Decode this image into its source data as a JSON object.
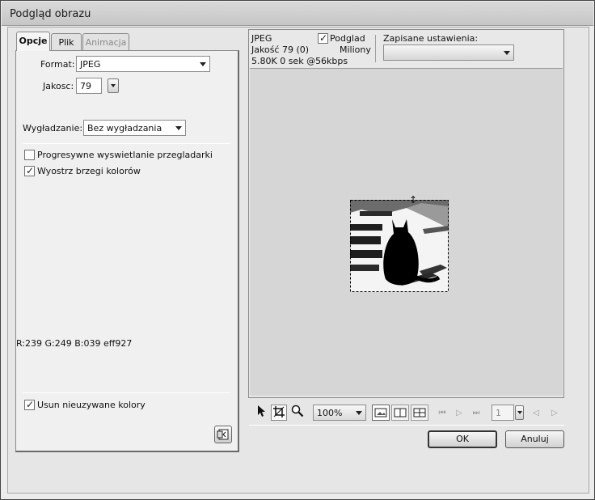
{
  "window": {
    "title": "Podgląd obrazu"
  },
  "tabs": [
    {
      "label": "Opcje",
      "active": true,
      "enabled": true
    },
    {
      "label": "Plik",
      "active": false,
      "enabled": true
    },
    {
      "label": "Animacja",
      "active": false,
      "enabled": false
    }
  ],
  "options": {
    "format_label": "Format:",
    "format_value": "JPEG",
    "quality_label": "Jakosc:",
    "quality_value": "79",
    "smoothing_label": "Wygładzanie:",
    "smoothing_value": "Bez wygładzania",
    "progressive": {
      "label": "Progresywne wyswietlanie przegladarki",
      "checked": false
    },
    "sharpen": {
      "label": "Wyostrz brzegi kolorów",
      "checked": true
    },
    "color_readout": "R:239 G:249 B:039 eff927",
    "remove_unused": {
      "label": "Usun nieuzywane kolory",
      "checked": true
    }
  },
  "preview_info": {
    "format": "JPEG",
    "quality": "Jakość 79 (0)",
    "size_time": "5.80K  0 sek @56kbps",
    "preview_label": "Podglad",
    "preview_checked": true,
    "colors": "Miliony",
    "saved_settings_label": "Zapisane ustawienia:",
    "saved_settings_value": ""
  },
  "toolbar": {
    "zoom_value": "100%",
    "frame_value": "1",
    "icons": [
      "pointer-icon",
      "crop-icon",
      "zoom-icon",
      "single-view-icon",
      "two-view-icon",
      "four-view-icon"
    ]
  },
  "buttons": {
    "ok": "OK",
    "cancel": "Anuluj"
  },
  "colors": {
    "preview_bg": "#d6d6d6",
    "panel_bg": "#e6e6e6",
    "text": "#111111"
  }
}
